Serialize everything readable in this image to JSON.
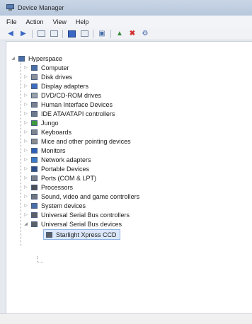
{
  "window": {
    "title": "Device Manager"
  },
  "menu": [
    "File",
    "Action",
    "View",
    "Help"
  ],
  "toolbar": {
    "back_icon": "back-arrow-icon",
    "forward_icon": "forward-arrow-icon"
  },
  "tree": {
    "root": "Hyperspace",
    "items": [
      {
        "label": "Computer",
        "icon": "computer-icon",
        "color": "#4a6fa8"
      },
      {
        "label": "Disk drives",
        "icon": "disk-drive-icon",
        "color": "#8a8f98"
      },
      {
        "label": "Display adapters",
        "icon": "display-adapter-icon",
        "color": "#3d6cc0"
      },
      {
        "label": "DVD/CD-ROM drives",
        "icon": "dvd-drive-icon",
        "color": "#9aa0a8"
      },
      {
        "label": "Human Interface Devices",
        "icon": "hid-icon",
        "color": "#7a8090"
      },
      {
        "label": "IDE ATA/ATAPI controllers",
        "icon": "ide-controller-icon",
        "color": "#6d7a8c"
      },
      {
        "label": "Jungo",
        "icon": "jungo-icon",
        "color": "#3a9a3a"
      },
      {
        "label": "Keyboards",
        "icon": "keyboard-icon",
        "color": "#7d8490"
      },
      {
        "label": "Mice and other pointing devices",
        "icon": "mouse-icon",
        "color": "#8c8c8c"
      },
      {
        "label": "Monitors",
        "icon": "monitor-icon",
        "color": "#2f5fb8"
      },
      {
        "label": "Network adapters",
        "icon": "network-adapter-icon",
        "color": "#3a7ac8"
      },
      {
        "label": "Portable Devices",
        "icon": "portable-device-icon",
        "color": "#2e4f8a"
      },
      {
        "label": "Ports (COM & LPT)",
        "icon": "port-icon",
        "color": "#7a7f88"
      },
      {
        "label": "Processors",
        "icon": "processor-icon",
        "color": "#4b4f57"
      },
      {
        "label": "Sound, video and game controllers",
        "icon": "sound-icon",
        "color": "#6f7680"
      },
      {
        "label": "System devices",
        "icon": "system-device-icon",
        "color": "#4a6fa8"
      },
      {
        "label": "Universal Serial Bus controllers",
        "icon": "usb-icon",
        "color": "#5b6066"
      },
      {
        "label": "Universal Serial Bus devices",
        "icon": "usb-icon",
        "color": "#5b6066"
      }
    ],
    "child": {
      "label": "Starlight Xpress CCD",
      "icon": "usb-device-icon",
      "color": "#5b6066"
    }
  }
}
